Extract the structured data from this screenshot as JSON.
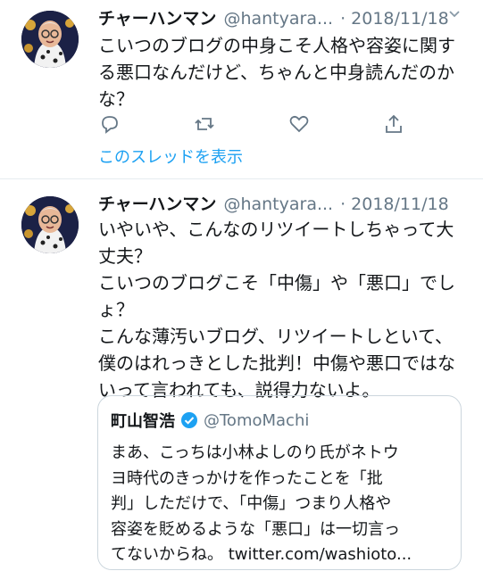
{
  "colors": {
    "accent": "#1da1f2",
    "secondary_text": "#657786",
    "divider": "#e6ecf0"
  },
  "tweets": [
    {
      "author_name": "チャーハンマン",
      "author_handle": "@hantyara...",
      "date": "· 2018/11/18",
      "lines": [
        "こいつのブログの中身こそ人格や容姿に関す",
        "る悪口なんだけど、ちゃんと中身読んだのか",
        "な？"
      ],
      "actions": [
        "reply-icon",
        "retweet-icon",
        "like-icon",
        "share-icon"
      ],
      "thread_link": "このスレッドを表示"
    },
    {
      "author_name": "チャーハンマン",
      "author_handle": "@hantyara...",
      "date": "· 2018/11/18",
      "lines": [
        "いやいや、こんなのリツイートしちゃって大",
        "丈夫？",
        "こいつのブログこそ「中傷」や「悪口」でし",
        "ょ？",
        "こんな薄汚いブログ、リツイートしといて、",
        "僕のはれっきとした批判！中傷や悪口ではな",
        "いって言われても、説得力ないよ。"
      ],
      "quote": {
        "name": "町山智浩",
        "handle": "@TomoMachi",
        "lines": [
          "まあ、こっちは小林よしのり氏がネトウ",
          "ヨ時代のきっかけを作ったことを「批",
          "判」しただけで、「中傷」つまり人格や",
          "容姿を貶めるような「悪口」は一切言っ",
          "てないからね。 twitter.com/washioto..."
        ]
      }
    }
  ]
}
